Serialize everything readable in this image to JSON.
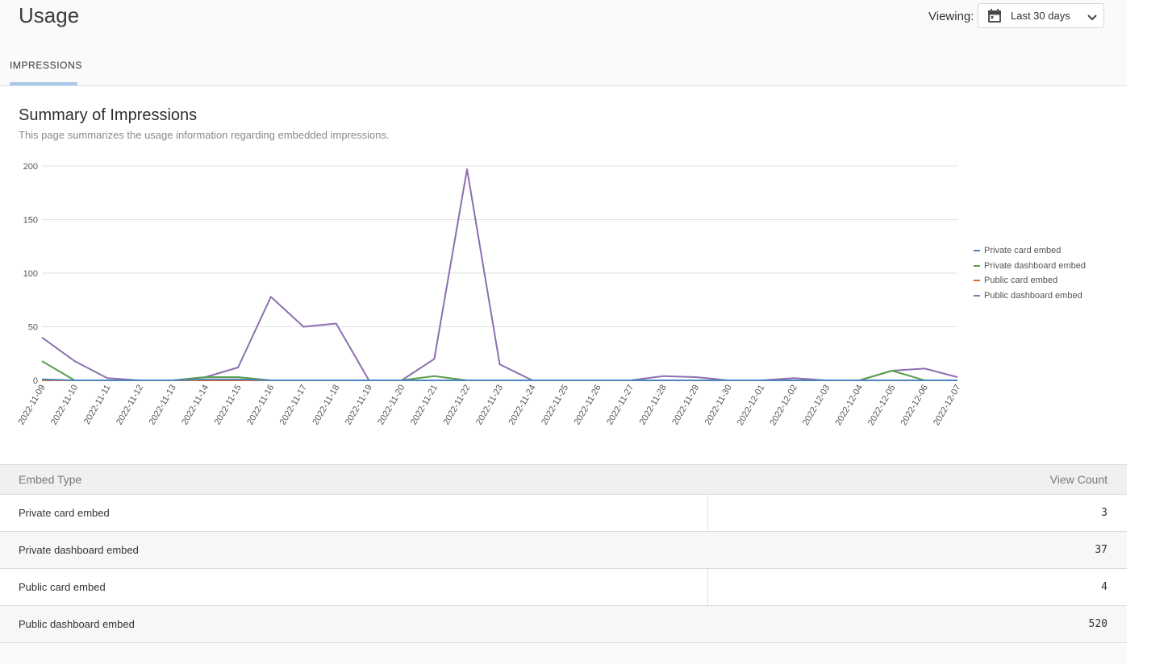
{
  "header": {
    "title": "Usage",
    "viewing_label": "Viewing:",
    "range_value": "Last 30 days"
  },
  "tabs": [
    {
      "label": "IMPRESSIONS",
      "active": true
    }
  ],
  "summary": {
    "title": "Summary of Impressions",
    "subtitle": "This page summarizes the usage information regarding embedded impressions."
  },
  "chart_data": {
    "type": "line",
    "title": "",
    "xlabel": "",
    "ylabel": "",
    "ylim": [
      0,
      200
    ],
    "yticks": [
      0,
      50,
      100,
      150,
      200
    ],
    "grid": true,
    "legend_position": "right",
    "x": [
      "2022-11-09",
      "2022-11-10",
      "2022-11-11",
      "2022-11-12",
      "2022-11-13",
      "2022-11-14",
      "2022-11-15",
      "2022-11-16",
      "2022-11-17",
      "2022-11-18",
      "2022-11-19",
      "2022-11-20",
      "2022-11-21",
      "2022-11-22",
      "2022-11-23",
      "2022-11-24",
      "2022-11-25",
      "2022-11-26",
      "2022-11-27",
      "2022-11-28",
      "2022-11-29",
      "2022-11-30",
      "2022-12-01",
      "2022-12-02",
      "2022-12-03",
      "2022-12-04",
      "2022-12-05",
      "2022-12-06",
      "2022-12-07"
    ],
    "series": [
      {
        "name": "Public dashboard embed",
        "color": "#8c6fb0",
        "values": [
          40,
          18,
          2,
          0,
          0,
          3,
          12,
          78,
          50,
          53,
          0,
          0,
          20,
          197,
          15,
          0,
          0,
          0,
          0,
          4,
          3,
          0,
          0,
          2,
          0,
          0,
          9,
          11,
          3
        ]
      },
      {
        "name": "Public card embed",
        "color": "#e0672b",
        "values": [
          0,
          0,
          0,
          0,
          0,
          0,
          0,
          0,
          0,
          0,
          0,
          0,
          0,
          0,
          0,
          0,
          0,
          0,
          0,
          0,
          0,
          0,
          0,
          0,
          0,
          0,
          0,
          0,
          0
        ]
      },
      {
        "name": "Private dashboard embed",
        "color": "#5a9e4a",
        "values": [
          18,
          0,
          0,
          0,
          0,
          3,
          3,
          0,
          0,
          0,
          0,
          0,
          4,
          0,
          0,
          0,
          0,
          0,
          0,
          0,
          0,
          0,
          0,
          0,
          0,
          0,
          9,
          0,
          0
        ]
      },
      {
        "name": "Private card embed",
        "color": "#4d86bf",
        "values": [
          1,
          0,
          0,
          0,
          0,
          1,
          1,
          0,
          0,
          0,
          0,
          0,
          0,
          0,
          0,
          0,
          0,
          0,
          0,
          0,
          0,
          0,
          0,
          0,
          0,
          0,
          0,
          0,
          0
        ]
      }
    ]
  },
  "legend": [
    {
      "label": "Private card embed",
      "color": "#4d86bf"
    },
    {
      "label": "Private dashboard embed",
      "color": "#5a9e4a"
    },
    {
      "label": "Public card embed",
      "color": "#e0672b"
    },
    {
      "label": "Public dashboard embed",
      "color": "#8c6fb0"
    }
  ],
  "table": {
    "headers": {
      "type": "Embed Type",
      "count": "View Count"
    },
    "rows": [
      {
        "type": "Private card embed",
        "count": "3"
      },
      {
        "type": "Private dashboard embed",
        "count": "37"
      },
      {
        "type": "Public card embed",
        "count": "4"
      },
      {
        "type": "Public dashboard embed",
        "count": "520"
      }
    ]
  },
  "icons": {
    "range": "calendar-icon",
    "dropdown": "chevron-down-icon"
  }
}
